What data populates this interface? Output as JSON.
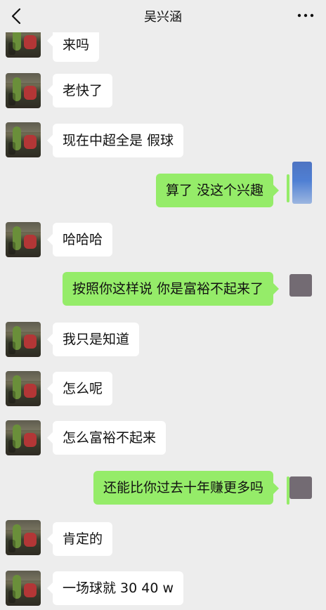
{
  "header": {
    "title": "吴兴涵",
    "back_icon": "chevron-left-icon",
    "more_icon": "more-dots-icon"
  },
  "messages": [
    {
      "side": "left",
      "text": "来吗"
    },
    {
      "side": "left",
      "text": "老快了"
    },
    {
      "side": "left",
      "text": "现在中超全是 假球"
    },
    {
      "side": "right",
      "text": "算了 没这个兴趣"
    },
    {
      "side": "left",
      "text": "哈哈哈"
    },
    {
      "side": "right",
      "text": "按照你这样说 你是富裕不起来了"
    },
    {
      "side": "left",
      "text": "我只是知道"
    },
    {
      "side": "left",
      "text": "怎么呢"
    },
    {
      "side": "left",
      "text": "怎么富裕不起来"
    },
    {
      "side": "right",
      "text": "还能比你过去十年赚更多吗"
    },
    {
      "side": "left",
      "text": "肯定的"
    },
    {
      "side": "left",
      "text": "一场球就 30 40 w"
    }
  ]
}
